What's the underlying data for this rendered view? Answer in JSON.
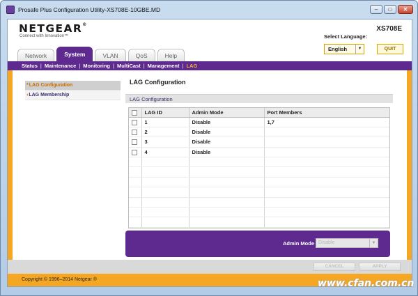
{
  "window": {
    "title": "Prosafe Plus Configuration Utility-XS708E-10GBE.MD",
    "controls": {
      "minimize": "–",
      "maximize": "□",
      "close": "✕"
    }
  },
  "header": {
    "brand": "NETGEAR",
    "brand_mark": "®",
    "tagline": "Connect with Innovation™",
    "model": "XS708E",
    "language_label": "Select Language:",
    "language_value": "English",
    "quit_label": "QUIT"
  },
  "tabs": [
    {
      "label": "Network",
      "active": false
    },
    {
      "label": "System",
      "active": true
    },
    {
      "label": "VLAN",
      "active": false
    },
    {
      "label": "QoS",
      "active": false
    },
    {
      "label": "Help",
      "active": false
    }
  ],
  "subnav": [
    {
      "label": "Status",
      "active": false
    },
    {
      "label": "Maintenance",
      "active": false
    },
    {
      "label": "Monitoring",
      "active": false
    },
    {
      "label": "MultiCast",
      "active": false
    },
    {
      "label": "Management",
      "active": false
    },
    {
      "label": "LAG",
      "active": true
    }
  ],
  "sidebar": {
    "items": [
      {
        "marker": "*",
        "label": "LAG Configuration",
        "active": true
      },
      {
        "marker": "›",
        "label": "LAG Membership",
        "active": false
      }
    ]
  },
  "main": {
    "page_title": "LAG Configuration",
    "section_title": "LAG Configuration",
    "table": {
      "columns": [
        "LAG ID",
        "Admin Mode",
        "Port Members"
      ],
      "rows": [
        {
          "id": "1",
          "mode": "Disable",
          "members": "1,7"
        },
        {
          "id": "2",
          "mode": "Disable",
          "members": ""
        },
        {
          "id": "3",
          "mode": "Disable",
          "members": ""
        },
        {
          "id": "4",
          "mode": "Disable",
          "members": ""
        }
      ]
    }
  },
  "admin_panel": {
    "label": "Admin Mode",
    "select_value": "Disable"
  },
  "footer": {
    "cancel_label": "CANCEL",
    "apply_label": "APPLY",
    "copyright": "Copyright © 1996–2014 Netgear ®"
  },
  "watermark": "www.cfan.com.cn",
  "colors": {
    "purple": "#5e2a8f",
    "orange": "#f5a623",
    "active_subnav": "#f7b731"
  }
}
